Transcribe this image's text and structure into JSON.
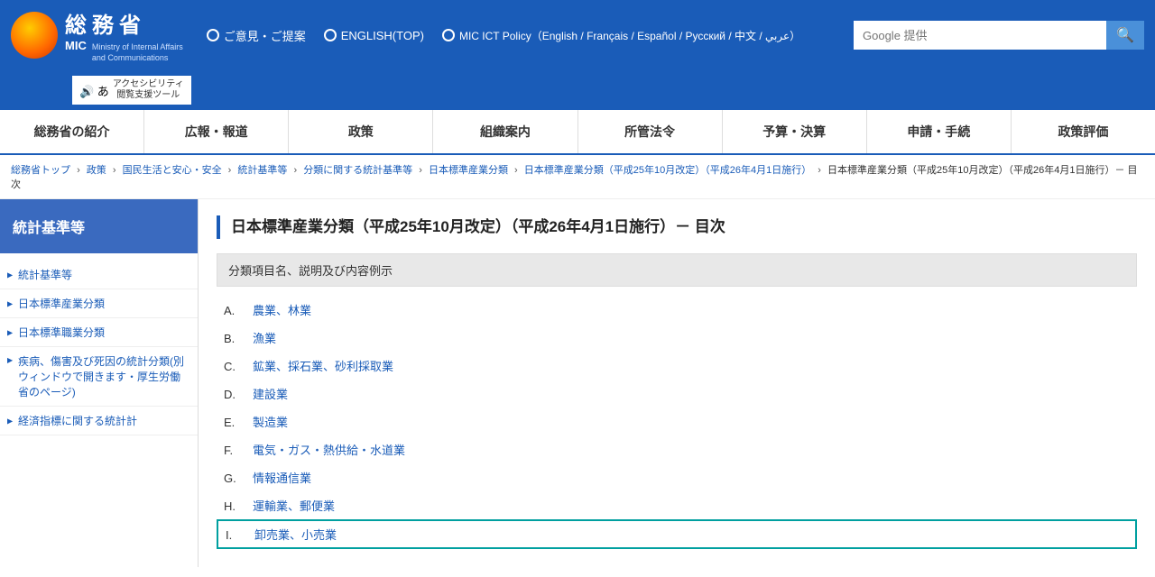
{
  "header": {
    "logo_kanji": "総務省",
    "logo_mic": "MIC",
    "logo_ministry_line1": "Ministry of Internal Affairs",
    "logo_ministry_line2": "and Communications",
    "link_opinion": "ご意見・ご提案",
    "link_english": "ENGLISH(TOP)",
    "link_mic_ict": "MIC ICT Policy（English / Français / Español / Русский / 中文 / عربي）",
    "accessibility_label": "アクセシビリティ",
    "accessibility_sub": "閲覧支援ツール",
    "search_placeholder": "Google 提供",
    "search_icon": "🔍"
  },
  "nav": {
    "items": [
      "総務省の紹介",
      "広報・報道",
      "政策",
      "組織案内",
      "所管法令",
      "予算・決算",
      "申請・手続",
      "政策評価"
    ]
  },
  "breadcrumb": {
    "items": [
      {
        "text": "総務省トップ",
        "href": "#"
      },
      {
        "text": "政策",
        "href": "#"
      },
      {
        "text": "国民生活と安心・安全",
        "href": "#"
      },
      {
        "text": "統計基準等",
        "href": "#"
      },
      {
        "text": "分類に関する統計基準等",
        "href": "#"
      },
      {
        "text": "日本標準産業分類",
        "href": "#"
      },
      {
        "text": "日本標準産業分類（平成25年10月改定）（平成26年4月1日施行）",
        "href": "#"
      }
    ],
    "current": "日本標準産業分類（平成25年10月改定）（平成26年4月1日施行）－ 目次"
  },
  "sidebar": {
    "title": "統計基準等",
    "items": [
      {
        "label": "統計基準等",
        "href": "#",
        "multiline": false
      },
      {
        "label": "日本標準産業分類",
        "href": "#",
        "multiline": false
      },
      {
        "label": "日本標準職業分類",
        "href": "#",
        "multiline": false
      },
      {
        "label": "疾病、傷害及び死因の統計分類(別ウィンドウで開きます・厚生労働省のページ)",
        "href": "#",
        "multiline": true
      },
      {
        "label": "経済指標に関する統計計",
        "href": "#",
        "multiline": false
      }
    ]
  },
  "main": {
    "page_title": "日本標準産業分類（平成25年10月改定）（平成26年4月1日施行）－ 目次",
    "table_header": "分類項目名、説明及び内容例示",
    "categories": [
      {
        "letter": "A.",
        "label": "農業、林業",
        "highlighted": false
      },
      {
        "letter": "B.",
        "label": "漁業",
        "highlighted": false
      },
      {
        "letter": "C.",
        "label": "鉱業、採石業、砂利採取業",
        "highlighted": false
      },
      {
        "letter": "D.",
        "label": "建設業",
        "highlighted": false
      },
      {
        "letter": "E.",
        "label": "製造業",
        "highlighted": false
      },
      {
        "letter": "F.",
        "label": "電気・ガス・熱供給・水道業",
        "highlighted": false
      },
      {
        "letter": "G.",
        "label": "情報通信業",
        "highlighted": false
      },
      {
        "letter": "H.",
        "label": "運輸業、郵便業",
        "highlighted": false
      },
      {
        "letter": "I.",
        "label": "卸売業、小売業",
        "highlighted": true
      }
    ]
  }
}
